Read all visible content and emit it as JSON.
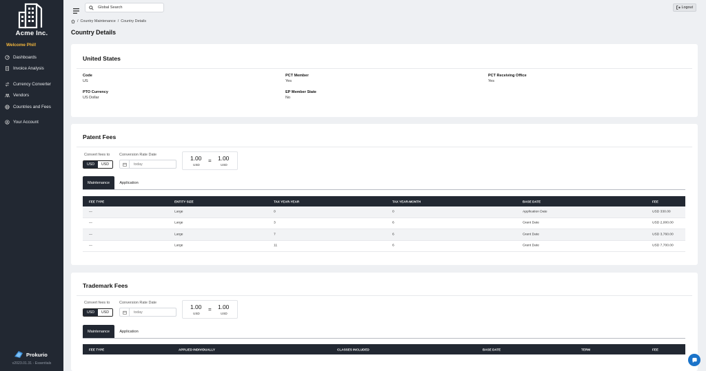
{
  "sidebar": {
    "company": "Acme Inc.",
    "welcome": "Welcome Phil!",
    "items": [
      {
        "label": "Dashboards",
        "icon": "dashboard-icon"
      },
      {
        "label": "Invoice Analysis",
        "icon": "invoice-icon"
      },
      {
        "label": "Currency Converter",
        "icon": "currency-icon"
      },
      {
        "label": "Vendors",
        "icon": "vendors-icon"
      },
      {
        "label": "Countries and Fees",
        "icon": "globe-icon"
      },
      {
        "label": "Your Account",
        "icon": "account-icon"
      }
    ],
    "brand": "Prokurio",
    "version": "v2023.01.31 - Essentials"
  },
  "topbar": {
    "search_placeholder": "Global Search",
    "logout_label": "Logout"
  },
  "breadcrumb": {
    "items": [
      "Country Maintenance",
      "Country Details"
    ]
  },
  "page_title": "Country Details",
  "country": {
    "name": "United States",
    "fields": [
      {
        "label": "Code",
        "value": "US"
      },
      {
        "label": "PCT Member",
        "value": "Yes"
      },
      {
        "label": "PCT Receiving Office",
        "value": "Yes"
      },
      {
        "label": "PTO Currency",
        "value": "US Dollar"
      },
      {
        "label": "EP Member State",
        "value": "No"
      }
    ]
  },
  "patent_fees": {
    "title": "Patent Fees",
    "convert_label": "Convert fees to",
    "toggle": [
      "USD",
      "USD"
    ],
    "date_label": "Conversion Rate Date",
    "date_placeholder": "today",
    "rate": {
      "from": "1.00",
      "from_cur": "USD",
      "eq": "=",
      "to": "1.00",
      "to_cur": "USD"
    },
    "tabs": [
      "Maintenance",
      "Application"
    ],
    "columns": [
      "FEE TYPE",
      "ENTITY SIZE",
      "TAX YEAR-YEAR",
      "TAX YEAR-MONTH",
      "BASE DATE",
      "FEE"
    ],
    "rows": [
      [
        "—",
        "Large",
        "0",
        "0",
        "Application Date",
        "USD 330.00"
      ],
      [
        "—",
        "Large",
        "3",
        "6",
        "Grant Date",
        "USD 2,000.00"
      ],
      [
        "—",
        "Large",
        "7",
        "6",
        "Grant Date",
        "USD 3,760.00"
      ],
      [
        "—",
        "Large",
        "11",
        "6",
        "Grant Date",
        "USD 7,700.00"
      ]
    ]
  },
  "trademark_fees": {
    "title": "Trademark Fees",
    "convert_label": "Convert fees to",
    "toggle": [
      "USD",
      "USD"
    ],
    "date_label": "Conversion Rate Date",
    "date_placeholder": "today",
    "rate": {
      "from": "1.00",
      "from_cur": "USD",
      "eq": "=",
      "to": "1.00",
      "to_cur": "USD"
    },
    "tabs": [
      "Maintenance",
      "Application"
    ],
    "columns": [
      "FEE TYPE",
      "APPLIED INDIVIDUALLY",
      "CLASSES INCLUDED",
      "BASE DATE",
      "TERM",
      "FEE"
    ]
  },
  "colors": {
    "sidebar_bg": "#222832",
    "accent_welcome": "#f4b73d",
    "chat_button": "#1a73c9"
  }
}
